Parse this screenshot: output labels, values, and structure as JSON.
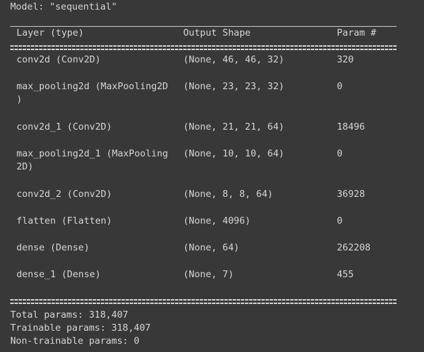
{
  "model_title": "Model: \"sequential\"",
  "header": {
    "layer": "Layer (type)",
    "shape": "Output Shape",
    "param": "Param #"
  },
  "rows": [
    {
      "layer": "conv2d (Conv2D)",
      "layer2": "",
      "shape": "(None, 46, 46, 32)",
      "param": "320"
    },
    {
      "layer": "max_pooling2d (MaxPooling2D",
      "layer2": ")",
      "shape": "(None, 23, 23, 32)",
      "param": "0"
    },
    {
      "layer": "conv2d_1 (Conv2D)",
      "layer2": "",
      "shape": "(None, 21, 21, 64)",
      "param": "18496"
    },
    {
      "layer": "max_pooling2d_1 (MaxPooling",
      "layer2": "2D)",
      "shape": "(None, 10, 10, 64)",
      "param": "0"
    },
    {
      "layer": "conv2d_2 (Conv2D)",
      "layer2": "",
      "shape": "(None, 8, 8, 64)",
      "param": "36928"
    },
    {
      "layer": "flatten (Flatten)",
      "layer2": "",
      "shape": "(None, 4096)",
      "param": "0"
    },
    {
      "layer": "dense (Dense)",
      "layer2": "",
      "shape": "(None, 64)",
      "param": "262208"
    },
    {
      "layer": "dense_1 (Dense)",
      "layer2": "",
      "shape": "(None, 7)",
      "param": "455"
    }
  ],
  "summary": {
    "total": "Total params: 318,407",
    "trainable": "Trainable params: 318,407",
    "non_trainable": "Non-trainable params: 0"
  }
}
